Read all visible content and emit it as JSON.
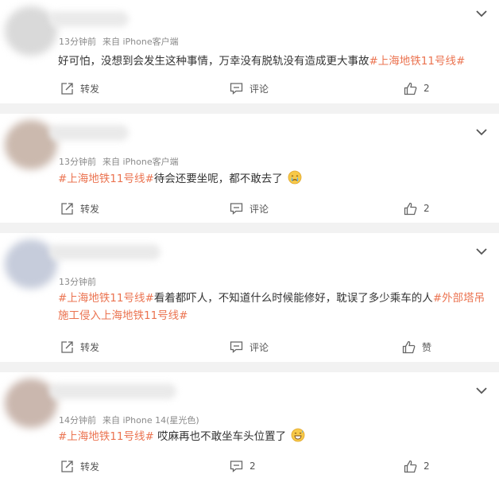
{
  "comments": [
    {
      "time": "13分钟前",
      "source": "来自 iPhone客户端",
      "text_plain": "好可怕，没想到会发生这种事情，万幸没有脱轨没有造成更大事故",
      "tag1": "#上海地铁11号线#",
      "repost": "转发",
      "comment": "评论",
      "likes": "2",
      "avatar_color": "#d6d6d6"
    },
    {
      "time": "13分钟前",
      "source": "来自 iPhone客户端",
      "tag1": "#上海地铁11号线#",
      "text_plain": "待会还要坐呢，都不敢去了",
      "emoji": "crying-face-icon",
      "repost": "转发",
      "comment": "评论",
      "likes": "2",
      "avatar_color": "#c9b9b0"
    },
    {
      "time": "13分钟前",
      "tag1": "#上海地铁11号线#",
      "text_plain": "看着都吓人，不知道什么时候能修好，耽误了多少乘车的人",
      "tag2": "#外部塔吊施工侵入上海地铁11号线#",
      "repost": "转发",
      "comment": "评论",
      "likes": "赞",
      "avatar_color": "#c5cbd9"
    },
    {
      "time": "14分钟前",
      "source": "来自 iPhone 14(星光色)",
      "tag1": "#上海地铁11号线#",
      "text_plain": " 哎麻再也不敢坐车头位置了",
      "emoji": "grinning-sweat-face-icon",
      "repost": "转发",
      "comment": "2",
      "likes": "2",
      "avatar_color": "#c9b5ad"
    }
  ],
  "colors": {
    "accent": "#eb7350",
    "background": "#f2f2f2",
    "meta": "#8a8a8a"
  }
}
